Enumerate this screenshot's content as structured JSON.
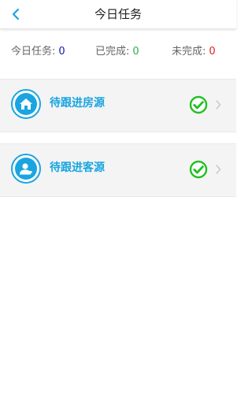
{
  "header": {
    "title": "今日任务",
    "back_icon": "chevron-left-icon"
  },
  "stats": {
    "today_label": "今日任务:",
    "today_value": "0",
    "done_label": "已完成:",
    "done_value": "0",
    "undone_label": "未完成:",
    "undone_value": "0"
  },
  "tasks": [
    {
      "label": "待跟进房源",
      "icon": "house-icon",
      "status_icon": "check-circle-icon"
    },
    {
      "label": "待跟进客源",
      "icon": "person-icon",
      "status_icon": "check-circle-icon"
    }
  ],
  "colors": {
    "accent": "#1aa5e0",
    "today_value": "#1a1aa8",
    "done_value": "#2ab24a",
    "undone_value": "#e02020",
    "check": "#20c020"
  }
}
